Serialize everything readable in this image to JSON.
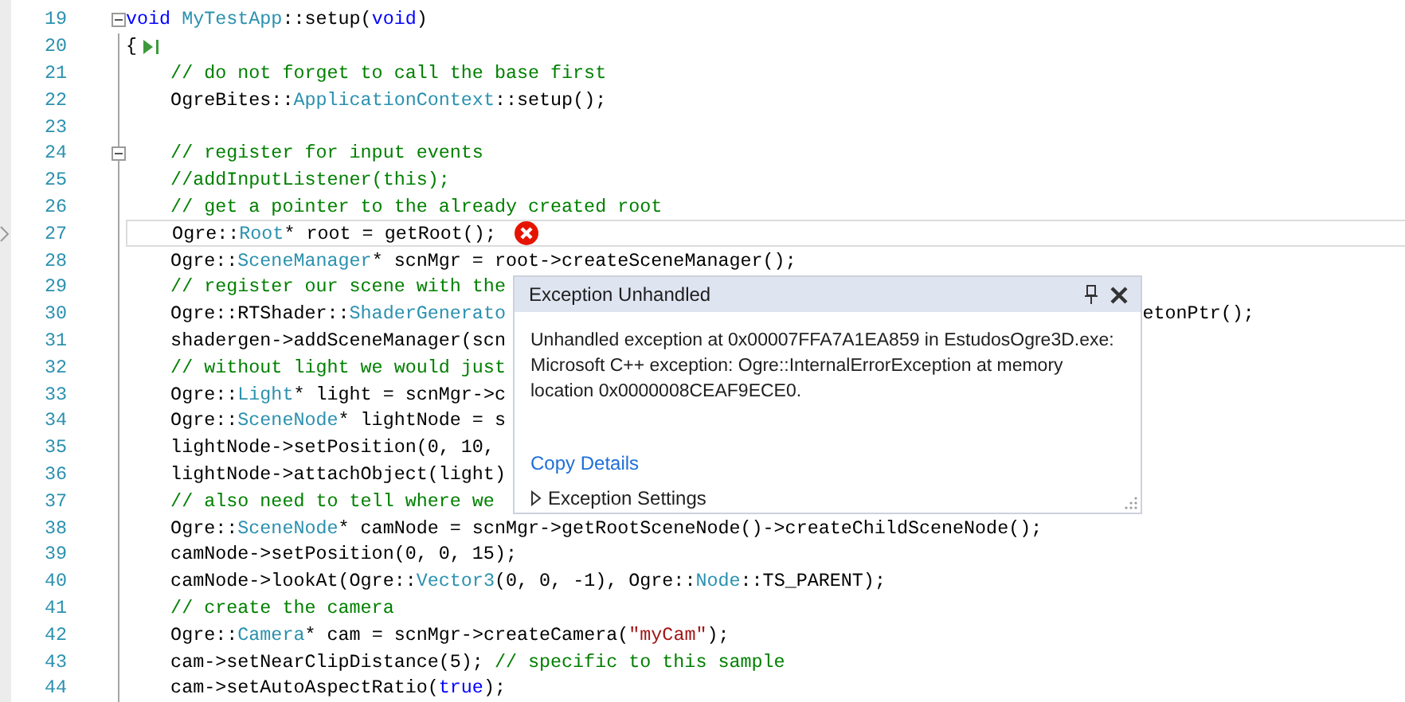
{
  "editor": {
    "lines": [
      {
        "number": "19",
        "current": false,
        "collapsible": true,
        "run_to_cursor": false,
        "error": false,
        "tokens": [
          {
            "kind": "keyword",
            "text": "void "
          },
          {
            "kind": "type",
            "text": "MyTestApp"
          },
          {
            "kind": "plain",
            "text": "::setup("
          },
          {
            "kind": "keyword",
            "text": "void"
          },
          {
            "kind": "plain",
            "text": ")"
          }
        ]
      },
      {
        "number": "20",
        "current": false,
        "collapsible": false,
        "run_to_cursor": true,
        "error": false,
        "tokens": [
          {
            "kind": "plain",
            "text": "{"
          }
        ]
      },
      {
        "number": "21",
        "current": false,
        "collapsible": false,
        "run_to_cursor": false,
        "error": false,
        "tokens": [
          {
            "kind": "comment",
            "text": "    // do not forget to call the base first"
          }
        ]
      },
      {
        "number": "22",
        "current": false,
        "collapsible": false,
        "run_to_cursor": false,
        "error": false,
        "tokens": [
          {
            "kind": "plain",
            "text": "    OgreBites::"
          },
          {
            "kind": "type",
            "text": "ApplicationContext"
          },
          {
            "kind": "plain",
            "text": "::setup();"
          }
        ]
      },
      {
        "number": "23",
        "current": false,
        "collapsible": false,
        "run_to_cursor": false,
        "error": false
      },
      {
        "number": "24",
        "current": false,
        "collapsible": true,
        "run_to_cursor": false,
        "error": false,
        "tokens": [
          {
            "kind": "comment",
            "text": "    // register for input events"
          }
        ]
      },
      {
        "number": "25",
        "current": false,
        "collapsible": false,
        "run_to_cursor": false,
        "error": false,
        "tokens": [
          {
            "kind": "comment",
            "text": "    //addInputListener(this);"
          }
        ]
      },
      {
        "number": "26",
        "current": false,
        "collapsible": false,
        "run_to_cursor": false,
        "error": false,
        "tokens": [
          {
            "kind": "comment",
            "text": "    // get a pointer to the already created root"
          }
        ]
      },
      {
        "number": "27",
        "current": true,
        "collapsible": false,
        "run_to_cursor": false,
        "error": true,
        "tokens": [
          {
            "kind": "plain",
            "text": "    Ogre::"
          },
          {
            "kind": "type",
            "text": "Root"
          },
          {
            "kind": "plain",
            "text": "* root = getRoot();"
          }
        ]
      },
      {
        "number": "28",
        "current": false,
        "collapsible": false,
        "run_to_cursor": false,
        "error": false,
        "tokens": [
          {
            "kind": "plain",
            "text": "    Ogre::"
          },
          {
            "kind": "type",
            "text": "SceneManager"
          },
          {
            "kind": "plain",
            "text": "* scnMgr = root->createSceneManager();"
          }
        ]
      },
      {
        "number": "29",
        "current": false,
        "collapsible": false,
        "run_to_cursor": false,
        "error": false,
        "tokens": [
          {
            "kind": "comment",
            "text": "    // register our scene with the"
          }
        ]
      },
      {
        "number": "30",
        "current": false,
        "collapsible": false,
        "run_to_cursor": false,
        "error": false,
        "tokens": [
          {
            "kind": "plain",
            "text": "    Ogre::RTShader::"
          },
          {
            "kind": "type",
            "text": "ShaderGenerato"
          }
        ],
        "tail": "etonPtr();"
      },
      {
        "number": "31",
        "current": false,
        "collapsible": false,
        "run_to_cursor": false,
        "error": false,
        "tokens": [
          {
            "kind": "plain",
            "text": "    shadergen->addSceneManager(scn"
          }
        ]
      },
      {
        "number": "32",
        "current": false,
        "collapsible": false,
        "run_to_cursor": false,
        "error": false,
        "tokens": [
          {
            "kind": "comment",
            "text": "    // without light we would just"
          }
        ]
      },
      {
        "number": "33",
        "current": false,
        "collapsible": false,
        "run_to_cursor": false,
        "error": false,
        "tokens": [
          {
            "kind": "plain",
            "text": "    Ogre::"
          },
          {
            "kind": "type",
            "text": "Light"
          },
          {
            "kind": "plain",
            "text": "* light = scnMgr->c"
          }
        ]
      },
      {
        "number": "34",
        "current": false,
        "collapsible": false,
        "run_to_cursor": false,
        "error": false,
        "tokens": [
          {
            "kind": "plain",
            "text": "    Ogre::"
          },
          {
            "kind": "type",
            "text": "SceneNode"
          },
          {
            "kind": "plain",
            "text": "* lightNode = s"
          }
        ]
      },
      {
        "number": "35",
        "current": false,
        "collapsible": false,
        "run_to_cursor": false,
        "error": false,
        "tokens": [
          {
            "kind": "plain",
            "text": "    lightNode->setPosition(0, 10,"
          }
        ]
      },
      {
        "number": "36",
        "current": false,
        "collapsible": false,
        "run_to_cursor": false,
        "error": false,
        "tokens": [
          {
            "kind": "plain",
            "text": "    lightNode->attachObject(light)"
          }
        ]
      },
      {
        "number": "37",
        "current": false,
        "collapsible": false,
        "run_to_cursor": false,
        "error": false,
        "tokens": [
          {
            "kind": "comment",
            "text": "    // also need to tell where we"
          }
        ]
      },
      {
        "number": "38",
        "current": false,
        "collapsible": false,
        "run_to_cursor": false,
        "error": false,
        "tokens": [
          {
            "kind": "plain",
            "text": "    Ogre::"
          },
          {
            "kind": "type",
            "text": "SceneNode"
          },
          {
            "kind": "plain",
            "text": "* camNode = scnMgr->getRootSceneNode()->createChildSceneNode();"
          }
        ]
      },
      {
        "number": "39",
        "current": false,
        "collapsible": false,
        "run_to_cursor": false,
        "error": false,
        "tokens": [
          {
            "kind": "plain",
            "text": "    camNode->setPosition(0, 0, 15);"
          }
        ]
      },
      {
        "number": "40",
        "current": false,
        "collapsible": false,
        "run_to_cursor": false,
        "error": false,
        "tokens": [
          {
            "kind": "plain",
            "text": "    camNode->lookAt(Ogre::"
          },
          {
            "kind": "type",
            "text": "Vector3"
          },
          {
            "kind": "plain",
            "text": "(0, 0, -1), Ogre::"
          },
          {
            "kind": "type",
            "text": "Node"
          },
          {
            "kind": "plain",
            "text": "::TS_PARENT);"
          }
        ]
      },
      {
        "number": "41",
        "current": false,
        "collapsible": false,
        "run_to_cursor": false,
        "error": false,
        "tokens": [
          {
            "kind": "comment",
            "text": "    // create the camera"
          }
        ]
      },
      {
        "number": "42",
        "current": false,
        "collapsible": false,
        "run_to_cursor": false,
        "error": false,
        "tokens": [
          {
            "kind": "plain",
            "text": "    Ogre::"
          },
          {
            "kind": "type",
            "text": "Camera"
          },
          {
            "kind": "plain",
            "text": "* cam = scnMgr->createCamera("
          },
          {
            "kind": "string",
            "text": "\"myCam\""
          },
          {
            "kind": "plain",
            "text": ");"
          }
        ]
      },
      {
        "number": "43",
        "current": false,
        "collapsible": false,
        "run_to_cursor": false,
        "error": false,
        "tokens": [
          {
            "kind": "plain",
            "text": "    cam->setNearClipDistance(5); "
          },
          {
            "kind": "comment",
            "text": "// specific to this sample"
          }
        ]
      },
      {
        "number": "44",
        "current": false,
        "collapsible": false,
        "run_to_cursor": false,
        "error": false,
        "tokens": [
          {
            "kind": "plain",
            "text": "    cam->setAutoAspectRatio("
          },
          {
            "kind": "keyword",
            "text": "true"
          },
          {
            "kind": "plain",
            "text": ");"
          }
        ]
      }
    ]
  },
  "exception_popup": {
    "title": "Exception Unhandled",
    "message": "Unhandled exception at 0x00007FFA7A1EA859 in EstudosOgre3D.exe: Microsoft C++ exception: Ogre::InternalErrorException at memory location 0x0000008CEAF9ECE0.",
    "link": "Copy Details",
    "settings": {
      "label": "Exception Settings",
      "expanded": false
    }
  }
}
